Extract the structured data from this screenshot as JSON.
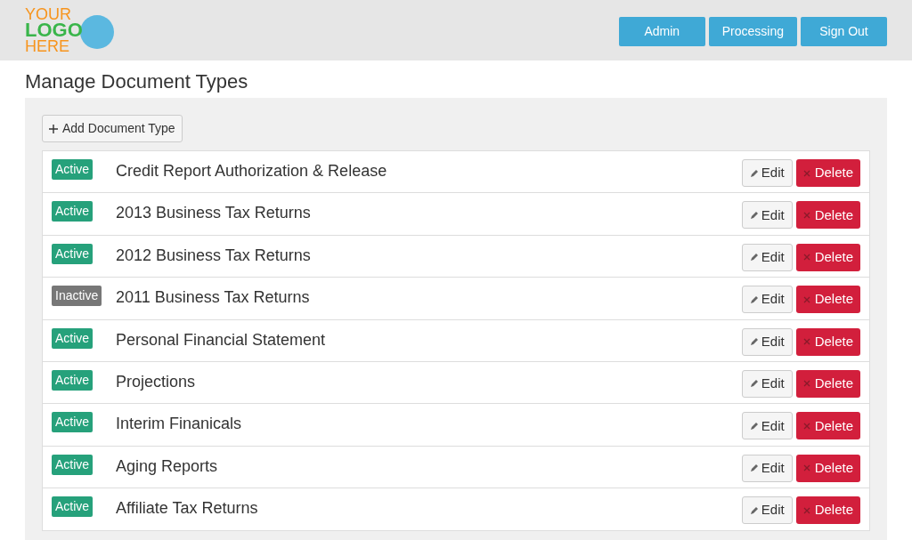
{
  "logo": {
    "lines": [
      "YOUR",
      "LOGO",
      "HERE"
    ]
  },
  "nav": [
    "Admin",
    "Processing",
    "Sign Out"
  ],
  "page_title": "Manage Document Types",
  "add_button": "Add Document Type",
  "rows": [
    {
      "status": "Active",
      "active": true,
      "name": "Credit Report Authorization & Release",
      "edit": "Edit",
      "delete": "Delete"
    },
    {
      "status": "Active",
      "active": true,
      "name": "2013 Business Tax Returns",
      "edit": "Edit",
      "delete": "Delete"
    },
    {
      "status": "Active",
      "active": true,
      "name": "2012 Business Tax Returns",
      "edit": "Edit",
      "delete": "Delete"
    },
    {
      "status": "Inactive",
      "active": false,
      "name": "2011 Business Tax Returns",
      "edit": "Edit",
      "delete": "Delete"
    },
    {
      "status": "Active",
      "active": true,
      "name": "Personal Financial Statement",
      "edit": "Edit",
      "delete": "Delete"
    },
    {
      "status": "Active",
      "active": true,
      "name": "Projections",
      "edit": "Edit",
      "delete": "Delete"
    },
    {
      "status": "Active",
      "active": true,
      "name": "Interim Finanicals",
      "edit": "Edit",
      "delete": "Delete"
    },
    {
      "status": "Active",
      "active": true,
      "name": "Aging Reports",
      "edit": "Edit",
      "delete": "Delete"
    },
    {
      "status": "Active",
      "active": true,
      "name": "Affiliate Tax Returns",
      "edit": "Edit",
      "delete": "Delete"
    }
  ]
}
